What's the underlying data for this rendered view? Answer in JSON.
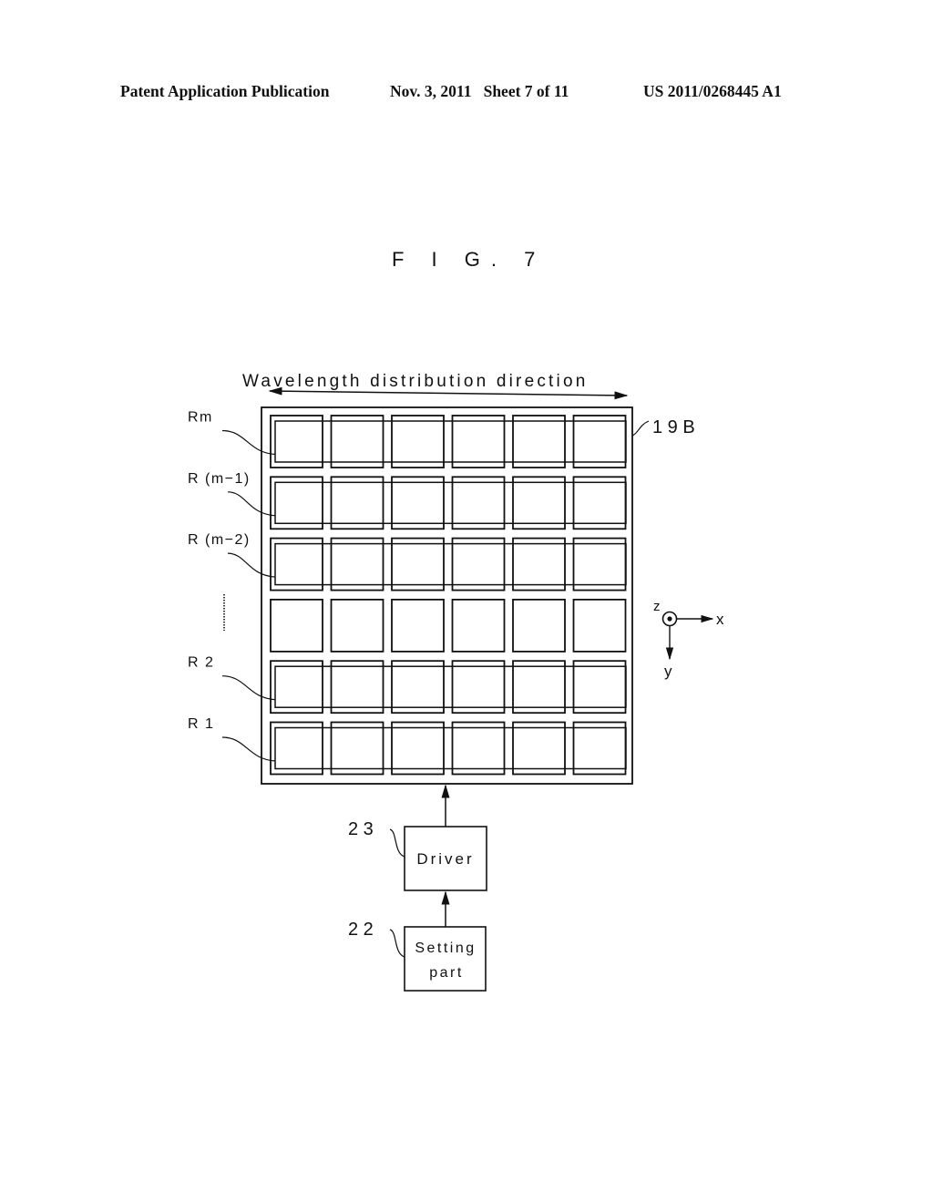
{
  "header": {
    "left": "Patent Application Publication",
    "middle": "Nov. 3, 2011   Sheet 7 of 11",
    "right": "US 2011/0268445 A1"
  },
  "figure": {
    "title": "F I G. 7",
    "direction_label": "Wavelength distribution direction",
    "panel_ref": "1 9 B",
    "grid": {
      "rows": 6,
      "columns": 6,
      "highlighted_rows": [
        0,
        1,
        2,
        4,
        5
      ],
      "unframed_rows": [
        3
      ]
    },
    "row_labels": [
      {
        "text": "Rm",
        "row": 0
      },
      {
        "text": "R (m−1)",
        "row": 1
      },
      {
        "text": "R (m−2)",
        "row": 2
      },
      {
        "text": "R 2",
        "row": 4
      },
      {
        "text": "R 1",
        "row": 5
      }
    ],
    "ellipsis_label": "ellipsis-vertical",
    "axes": {
      "z": "z",
      "x": "x",
      "y": "y"
    },
    "blocks": [
      {
        "ref": "2 3",
        "label_lines": [
          "Driver"
        ]
      },
      {
        "ref": "2 2",
        "label_lines": [
          "Setting",
          "part"
        ]
      }
    ]
  }
}
